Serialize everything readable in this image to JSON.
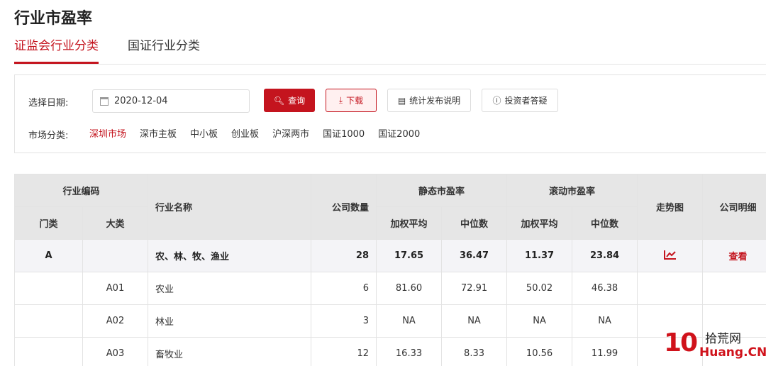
{
  "page_title": "行业市盈率",
  "tabs": [
    {
      "label": "证监会行业分类",
      "active": true
    },
    {
      "label": "国证行业分类",
      "active": false
    }
  ],
  "filter": {
    "date_label": "选择日期:",
    "date_value": "2020-12-04",
    "query_label": "查询",
    "download_label": "下载",
    "explain_label": "统计发布说明",
    "faq_label": "投资者答疑",
    "market_label": "市场分类:",
    "markets": [
      "深圳市场",
      "深市主板",
      "中小板",
      "创业板",
      "沪深两市",
      "国证1000",
      "国证2000"
    ],
    "active_market": "深圳市场"
  },
  "table": {
    "headers": {
      "industry_code": "行业编码",
      "category": "门类",
      "major": "大类",
      "industry_name": "行业名称",
      "company_count": "公司数量",
      "static_pe": "静态市盈率",
      "rolling_pe": "滚动市盈率",
      "weighted_avg": "加权平均",
      "median": "中位数",
      "trend": "走势图",
      "detail": "公司明细"
    },
    "rows": [
      {
        "category": "A",
        "major": "",
        "name": "农、林、牧、渔业",
        "count": "28",
        "s_avg": "17.65",
        "s_med": "36.47",
        "r_avg": "11.37",
        "r_med": "23.84",
        "detail": "查看",
        "is_major": true
      },
      {
        "category": "",
        "major": "A01",
        "name": "农业",
        "count": "6",
        "s_avg": "81.60",
        "s_med": "72.91",
        "r_avg": "50.02",
        "r_med": "46.38",
        "detail": "",
        "is_major": false
      },
      {
        "category": "",
        "major": "A02",
        "name": "林业",
        "count": "3",
        "s_avg": "NA",
        "s_med": "NA",
        "r_avg": "NA",
        "r_med": "NA",
        "detail": "",
        "is_major": false
      },
      {
        "category": "",
        "major": "A03",
        "name": "畜牧业",
        "count": "12",
        "s_avg": "16.33",
        "s_med": "8.33",
        "r_avg": "10.56",
        "r_med": "11.99",
        "detail": "",
        "is_major": false
      }
    ]
  },
  "watermark": {
    "cn": "拾荒网",
    "en": "Huang.CN",
    "logo": "10"
  },
  "colors": {
    "accent": "#c4141e",
    "header_bg": "#e6e6e6",
    "major_row_bg": "#f4f4f7"
  }
}
